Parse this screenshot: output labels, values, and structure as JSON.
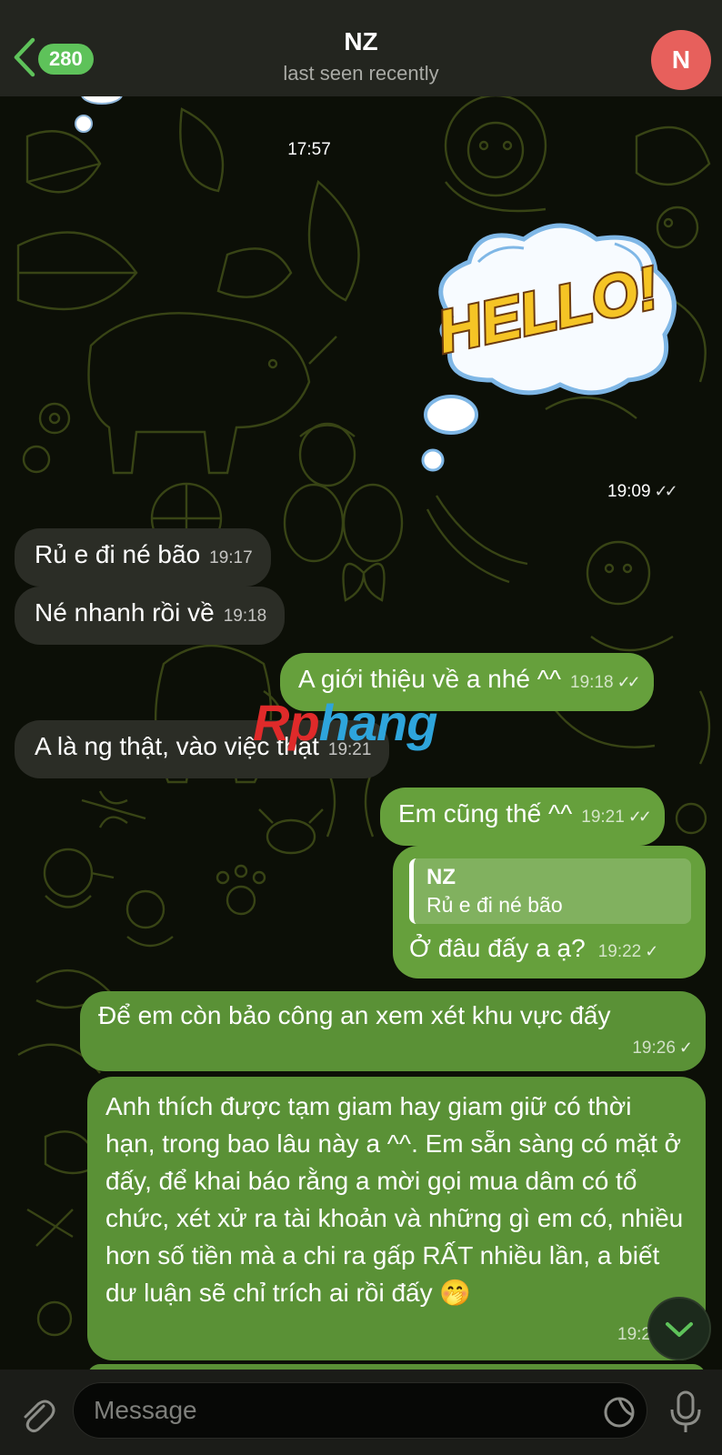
{
  "header": {
    "back_count": "280",
    "contact_name": "NZ",
    "status": "last seen recently",
    "avatar_initial": "N"
  },
  "chat": {
    "date_stamp": "17:57",
    "sticker": {
      "text": "HELLO!",
      "time": "19:09"
    },
    "messages": [
      {
        "dir": "in",
        "text": "Rủ e đi né bão",
        "time": "19:17"
      },
      {
        "dir": "in",
        "text": "Né nhanh rồi về",
        "time": "19:18"
      },
      {
        "dir": "out",
        "text": "A giới thiệu về a nhé ^^",
        "time": "19:18"
      },
      {
        "dir": "in",
        "text": "A là ng thật, vào việc thật",
        "time": "19:21"
      },
      {
        "dir": "out",
        "text": "Em cũng thế ^^",
        "time": "19:21"
      },
      {
        "dir": "out",
        "reply_name": "NZ",
        "reply_text": "Rủ e đi né bão",
        "text": "Ở đâu đấy a ạ?",
        "time": "19:22"
      },
      {
        "dir": "out",
        "text": "Để em còn bảo công an xem xét khu vực đấy",
        "time": "19:26"
      },
      {
        "dir": "out",
        "text": "Anh thích được tạm giam hay giam giữ có thời hạn, trong bao lâu này a ^^. Em sẵn sàng có mặt ở đấy, để khai báo rằng a mời gọi mua dâm có tổ chức, xét xử ra tài khoản và những gì em có, nhiều hơn số tiền mà a chi ra gấp RẤT nhiều lần, a biết dư luận sẽ chỉ trích ai rồi đấy 🤭",
        "time": "19:2"
      }
    ]
  },
  "watermark": {
    "part1": "Rp",
    "part2": "hang"
  },
  "input": {
    "placeholder": "Message"
  },
  "colors": {
    "outgoing": "#5a9136",
    "incoming": "#2b2d26",
    "badge": "#5ec25a",
    "avatar": "#e7605c"
  }
}
